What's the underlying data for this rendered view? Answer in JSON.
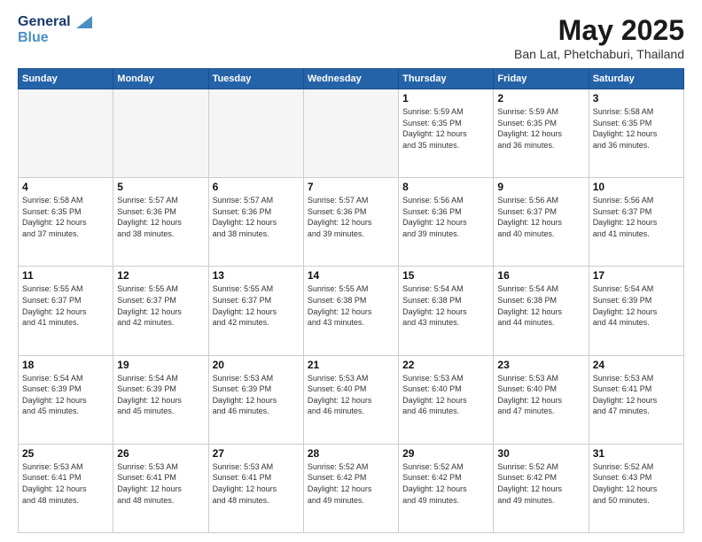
{
  "header": {
    "logo_line1": "General",
    "logo_line2": "Blue",
    "title": "May 2025",
    "subtitle": "Ban Lat, Phetchaburi, Thailand"
  },
  "weekdays": [
    "Sunday",
    "Monday",
    "Tuesday",
    "Wednesday",
    "Thursday",
    "Friday",
    "Saturday"
  ],
  "weeks": [
    [
      {
        "day": "",
        "empty": true
      },
      {
        "day": "",
        "empty": true
      },
      {
        "day": "",
        "empty": true
      },
      {
        "day": "",
        "empty": true
      },
      {
        "day": "1",
        "rise": "5:59 AM",
        "set": "6:35 PM",
        "hours": "12 hours",
        "mins": "35 minutes"
      },
      {
        "day": "2",
        "rise": "5:59 AM",
        "set": "6:35 PM",
        "hours": "12 hours",
        "mins": "36 minutes"
      },
      {
        "day": "3",
        "rise": "5:58 AM",
        "set": "6:35 PM",
        "hours": "12 hours",
        "mins": "36 minutes"
      }
    ],
    [
      {
        "day": "4",
        "rise": "5:58 AM",
        "set": "6:35 PM",
        "hours": "12 hours",
        "mins": "37 minutes"
      },
      {
        "day": "5",
        "rise": "5:57 AM",
        "set": "6:36 PM",
        "hours": "12 hours",
        "mins": "38 minutes"
      },
      {
        "day": "6",
        "rise": "5:57 AM",
        "set": "6:36 PM",
        "hours": "12 hours",
        "mins": "38 minutes"
      },
      {
        "day": "7",
        "rise": "5:57 AM",
        "set": "6:36 PM",
        "hours": "12 hours",
        "mins": "39 minutes"
      },
      {
        "day": "8",
        "rise": "5:56 AM",
        "set": "6:36 PM",
        "hours": "12 hours",
        "mins": "39 minutes"
      },
      {
        "day": "9",
        "rise": "5:56 AM",
        "set": "6:37 PM",
        "hours": "12 hours",
        "mins": "40 minutes"
      },
      {
        "day": "10",
        "rise": "5:56 AM",
        "set": "6:37 PM",
        "hours": "12 hours",
        "mins": "41 minutes"
      }
    ],
    [
      {
        "day": "11",
        "rise": "5:55 AM",
        "set": "6:37 PM",
        "hours": "12 hours",
        "mins": "41 minutes"
      },
      {
        "day": "12",
        "rise": "5:55 AM",
        "set": "6:37 PM",
        "hours": "12 hours",
        "mins": "42 minutes"
      },
      {
        "day": "13",
        "rise": "5:55 AM",
        "set": "6:37 PM",
        "hours": "12 hours",
        "mins": "42 minutes"
      },
      {
        "day": "14",
        "rise": "5:55 AM",
        "set": "6:38 PM",
        "hours": "12 hours",
        "mins": "43 minutes"
      },
      {
        "day": "15",
        "rise": "5:54 AM",
        "set": "6:38 PM",
        "hours": "12 hours",
        "mins": "43 minutes"
      },
      {
        "day": "16",
        "rise": "5:54 AM",
        "set": "6:38 PM",
        "hours": "12 hours",
        "mins": "44 minutes"
      },
      {
        "day": "17",
        "rise": "5:54 AM",
        "set": "6:39 PM",
        "hours": "12 hours",
        "mins": "44 minutes"
      }
    ],
    [
      {
        "day": "18",
        "rise": "5:54 AM",
        "set": "6:39 PM",
        "hours": "12 hours",
        "mins": "45 minutes"
      },
      {
        "day": "19",
        "rise": "5:54 AM",
        "set": "6:39 PM",
        "hours": "12 hours",
        "mins": "45 minutes"
      },
      {
        "day": "20",
        "rise": "5:53 AM",
        "set": "6:39 PM",
        "hours": "12 hours",
        "mins": "46 minutes"
      },
      {
        "day": "21",
        "rise": "5:53 AM",
        "set": "6:40 PM",
        "hours": "12 hours",
        "mins": "46 minutes"
      },
      {
        "day": "22",
        "rise": "5:53 AM",
        "set": "6:40 PM",
        "hours": "12 hours",
        "mins": "46 minutes"
      },
      {
        "day": "23",
        "rise": "5:53 AM",
        "set": "6:40 PM",
        "hours": "12 hours",
        "mins": "47 minutes"
      },
      {
        "day": "24",
        "rise": "5:53 AM",
        "set": "6:41 PM",
        "hours": "12 hours",
        "mins": "47 minutes"
      }
    ],
    [
      {
        "day": "25",
        "rise": "5:53 AM",
        "set": "6:41 PM",
        "hours": "12 hours",
        "mins": "48 minutes"
      },
      {
        "day": "26",
        "rise": "5:53 AM",
        "set": "6:41 PM",
        "hours": "12 hours",
        "mins": "48 minutes"
      },
      {
        "day": "27",
        "rise": "5:53 AM",
        "set": "6:41 PM",
        "hours": "12 hours",
        "mins": "48 minutes"
      },
      {
        "day": "28",
        "rise": "5:52 AM",
        "set": "6:42 PM",
        "hours": "12 hours",
        "mins": "49 minutes"
      },
      {
        "day": "29",
        "rise": "5:52 AM",
        "set": "6:42 PM",
        "hours": "12 hours",
        "mins": "49 minutes"
      },
      {
        "day": "30",
        "rise": "5:52 AM",
        "set": "6:42 PM",
        "hours": "12 hours",
        "mins": "49 minutes"
      },
      {
        "day": "31",
        "rise": "5:52 AM",
        "set": "6:43 PM",
        "hours": "12 hours",
        "mins": "50 minutes"
      }
    ]
  ],
  "labels": {
    "sunrise": "Sunrise:",
    "sunset": "Sunset:",
    "daylight": "Daylight:"
  }
}
